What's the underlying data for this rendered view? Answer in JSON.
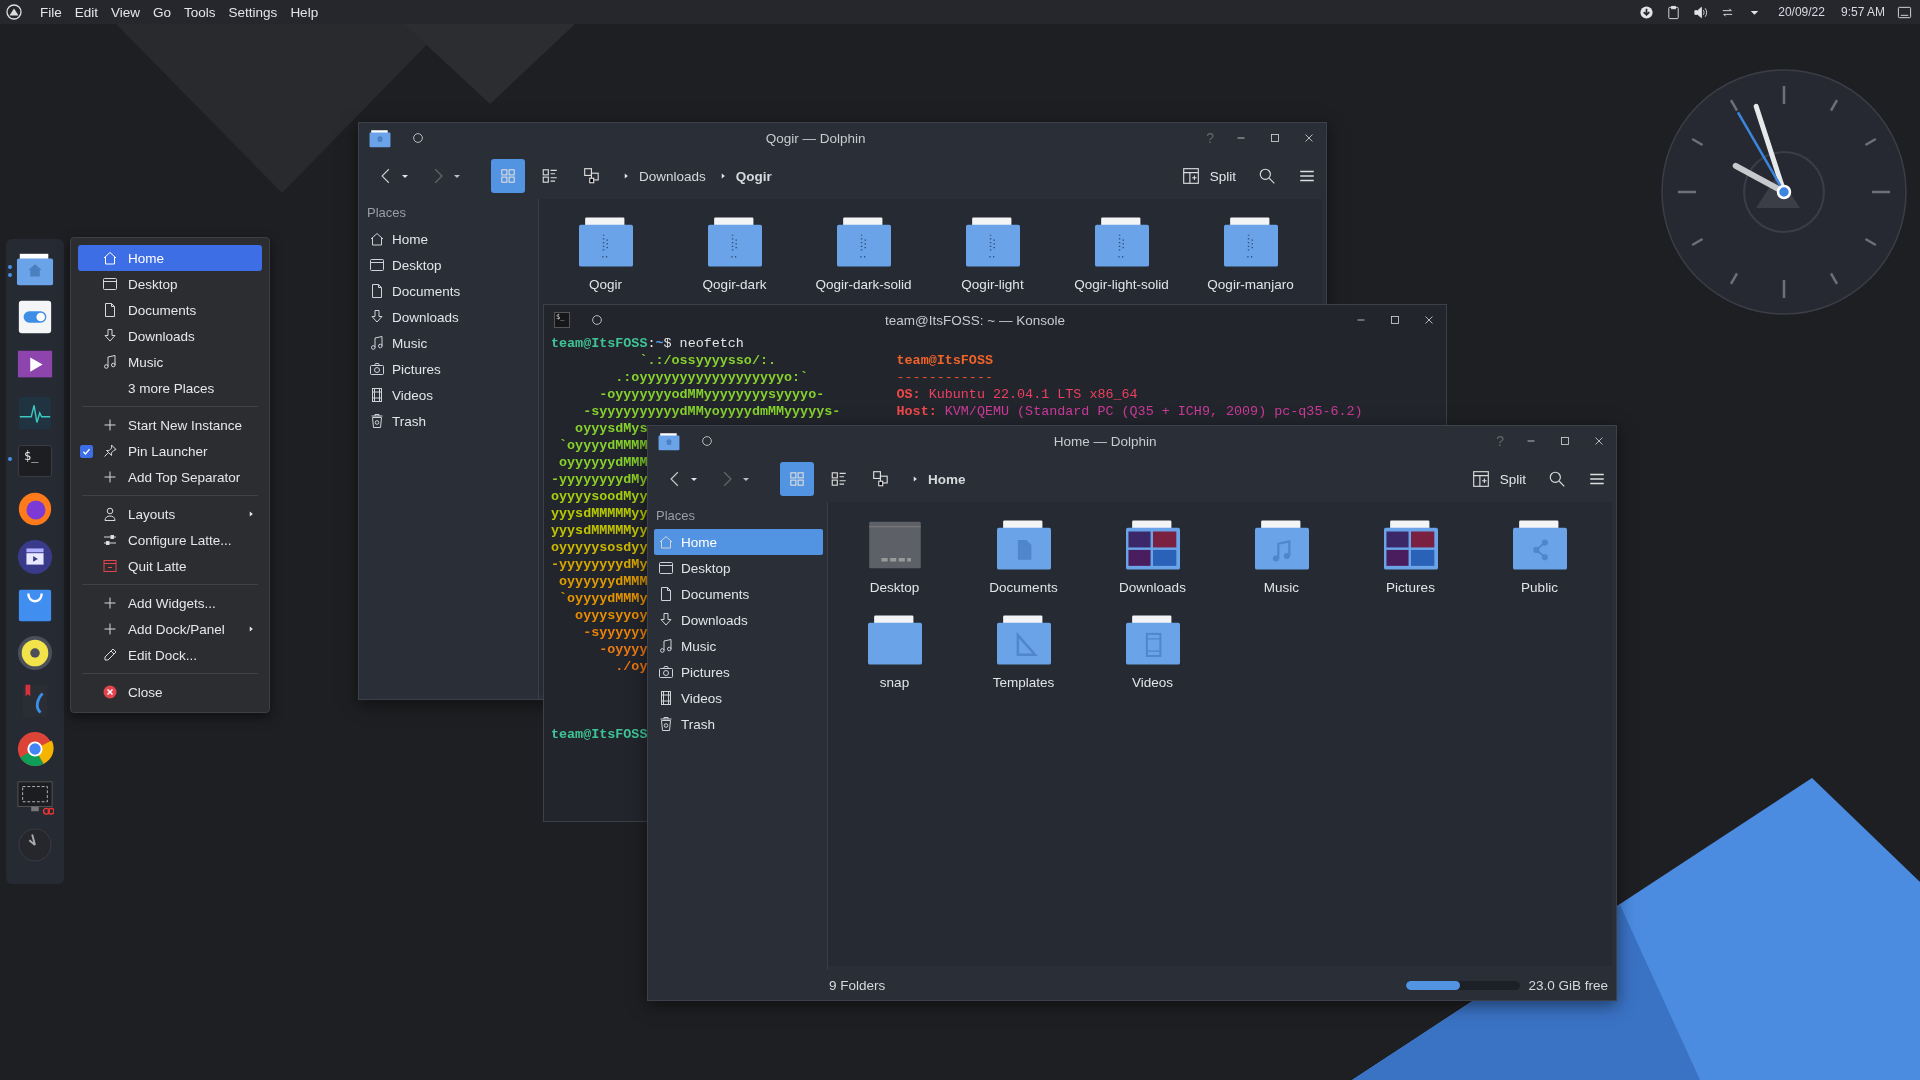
{
  "menubar": {
    "items": [
      "File",
      "Edit",
      "View",
      "Go",
      "Tools",
      "Settings",
      "Help"
    ]
  },
  "tray": {
    "date": "20/09/22",
    "time": "9:57 AM"
  },
  "dock": {
    "items": [
      {
        "running": true,
        "multiple": true
      },
      {
        "running": false
      },
      {
        "running": false
      },
      {
        "running": false
      },
      {
        "running": true,
        "label": "$_"
      },
      {
        "running": false
      },
      {
        "running": false
      },
      {
        "running": false
      },
      {
        "running": false
      },
      {
        "running": false
      },
      {
        "running": false
      },
      {
        "running": false
      },
      {
        "running": false
      }
    ]
  },
  "context_menu": {
    "sections": [
      [
        {
          "label": "Home",
          "kind": "place",
          "selected": true
        },
        {
          "label": "Desktop",
          "kind": "place",
          "selected": false
        },
        {
          "label": "Documents",
          "kind": "place",
          "selected": false
        },
        {
          "label": "Downloads",
          "kind": "place",
          "selected": false
        },
        {
          "label": "Music",
          "kind": "place",
          "selected": false
        },
        {
          "label": "3 more Places",
          "kind": "place",
          "selected": false
        }
      ],
      [
        {
          "label": "Start New Instance",
          "kind": "action",
          "selected": false
        },
        {
          "label": "Pin Launcher",
          "kind": "checkbox",
          "checked": true,
          "selected": false
        },
        {
          "label": "Add Top Separator",
          "kind": "action",
          "selected": false
        }
      ],
      [
        {
          "label": "Layouts",
          "kind": "action",
          "submenu": true,
          "selected": false
        },
        {
          "label": "Configure Latte...",
          "kind": "action",
          "selected": false
        },
        {
          "label": "Quit Latte",
          "kind": "action",
          "selected": false
        }
      ],
      [
        {
          "label": "Add Widgets...",
          "kind": "action",
          "selected": false
        },
        {
          "label": "Add Dock/Panel",
          "kind": "action",
          "submenu": true,
          "selected": false
        },
        {
          "label": "Edit Dock...",
          "kind": "action",
          "selected": false
        }
      ],
      [
        {
          "label": "Close",
          "kind": "action",
          "selected": false
        }
      ]
    ]
  },
  "back_window": {
    "title": "Qogir — Dolphin",
    "help": "?",
    "view_modes": [
      {
        "selected": true
      },
      {
        "selected": false
      },
      {
        "selected": false
      }
    ],
    "breadcrumb": [
      {
        "label": "Downloads",
        "current": false
      },
      {
        "label": "Qogir",
        "current": true
      }
    ],
    "split_label": "Split",
    "places_header": "Places",
    "places": [
      {
        "label": "Home",
        "selected": false
      },
      {
        "label": "Desktop",
        "selected": false
      },
      {
        "label": "Documents",
        "selected": false
      },
      {
        "label": "Downloads",
        "selected": false
      },
      {
        "label": "Music",
        "selected": false
      },
      {
        "label": "Pictures",
        "selected": false
      },
      {
        "label": "Videos",
        "selected": false
      },
      {
        "label": "Trash",
        "selected": false
      }
    ],
    "folders": [
      "Qogir",
      "Qogir-dark",
      "Qogir-dark-solid",
      "Qogir-light",
      "Qogir-light-solid",
      "Qogir-manjaro"
    ]
  },
  "konsole": {
    "title": "team@ItsFOSS: ~ — Konsole",
    "icon_text": "$_",
    "prompt": [
      {
        "text": "team@ItsFOSS",
        "kind": "user"
      },
      {
        "text": ":",
        "kind": "plain"
      },
      {
        "text": "~",
        "kind": "path"
      },
      {
        "text": "$ neofetch",
        "kind": "plain"
      }
    ],
    "art": [
      {
        "text": "           `.:/ossyyyysso/:.",
        "color": "#86d12c"
      },
      {
        "text": "        .:oyyyyyyyyyyyyyyyyyyo:`",
        "color": "#86d12c"
      },
      {
        "text": "      -oyyyyyyyodMMyyyyyyyysyyyyo-",
        "color": "#86d12c"
      },
      {
        "text": "    -syyyyyyyyyydMMyoyyyydmMMyyyyys-",
        "color": "#86d12c"
      },
      {
        "text": "   oyyysdMys",
        "color": "#86d12c"
      },
      {
        "text": " `oyyyydMMMM",
        "color": "#86d12c"
      },
      {
        "text": " oyyyyyydMMM",
        "color": "#86d12c"
      },
      {
        "text": "-yyyyyyyydMy",
        "color": "#8fd024"
      },
      {
        "text": "oyyyysoodMyy",
        "color": "#a6cf10"
      },
      {
        "text": "yyysdMMMMMyy",
        "color": "#b8ca00"
      },
      {
        "text": "yyysdMMMMMyy",
        "color": "#c2c400"
      },
      {
        "text": "oyyyyysosdyy",
        "color": "#ccb800"
      },
      {
        "text": "-yyyyyyyydMy",
        "color": "#d8a800"
      },
      {
        "text": " oyyyyyydMMM",
        "color": "#e09c00"
      },
      {
        "text": " `oyyyydMMMy",
        "color": "#e49400"
      },
      {
        "text": "   oyyysyyoy",
        "color": "#e88c00"
      },
      {
        "text": "    -syyyyyy",
        "color": "#ea8208"
      },
      {
        "text": "      -oyyyy",
        "color": "#ec7a10"
      },
      {
        "text": "        ./oy",
        "color": "#ec7410"
      }
    ],
    "info": [
      {
        "kind": "title",
        "text": "team@ItsFOSS"
      },
      {
        "kind": "rule",
        "text": "------------"
      },
      {
        "kind": "field",
        "label": "OS:",
        "value": "Kubuntu 22.04.1 LTS x86_64"
      },
      {
        "kind": "field",
        "label": "Host:",
        "value": "KVM/QEMU (Standard PC (Q35 + ICH9, 2009) pc-q35-6.2)"
      }
    ],
    "final_prompt": "team@ItsFOSS"
  },
  "front_window": {
    "title": "Home — Dolphin",
    "help": "?",
    "view_modes": [
      {
        "selected": true
      },
      {
        "selected": false
      },
      {
        "selected": false
      }
    ],
    "breadcrumb": [
      {
        "label": "Home",
        "current": true
      }
    ],
    "split_label": "Split",
    "places_header": "Places",
    "places": [
      {
        "label": "Home",
        "selected": true
      },
      {
        "label": "Desktop",
        "selected": false
      },
      {
        "label": "Documents",
        "selected": false
      },
      {
        "label": "Downloads",
        "selected": false
      },
      {
        "label": "Music",
        "selected": false
      },
      {
        "label": "Pictures",
        "selected": false
      },
      {
        "label": "Videos",
        "selected": false
      },
      {
        "label": "Trash",
        "selected": false
      }
    ],
    "folders": [
      "Desktop",
      "Documents",
      "Downloads",
      "Music",
      "Pictures",
      "Public",
      "snap",
      "Templates",
      "Videos"
    ],
    "status": "9 Folders",
    "free_space": {
      "level": 0.47,
      "label": "23.0 GiB free"
    }
  }
}
